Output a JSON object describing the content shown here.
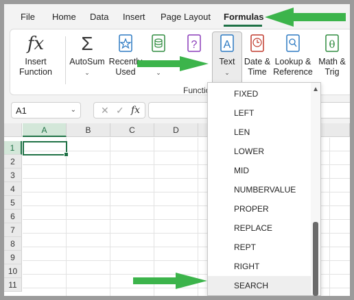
{
  "menu": {
    "tabs": [
      {
        "label": "File"
      },
      {
        "label": "Home"
      },
      {
        "label": "Data"
      },
      {
        "label": "Insert"
      },
      {
        "label": "Page Layout"
      },
      {
        "label": "Formulas"
      }
    ],
    "active": "Formulas"
  },
  "ribbon": {
    "insert_function": {
      "line1": "Insert",
      "line2": "Function"
    },
    "autosum": {
      "label": "AutoSum"
    },
    "recently_used": {
      "line1": "Recently",
      "line2": "Used"
    },
    "text": {
      "label": "Text"
    },
    "date_time": {
      "line1": "Date &",
      "line2": "Time"
    },
    "lookup": {
      "line1": "Lookup &",
      "line2": "Reference"
    },
    "math": {
      "line1": "Math &",
      "line2": "Trig"
    },
    "group_label": "Function"
  },
  "formula_bar": {
    "name_box": "A1",
    "fx": "fx"
  },
  "grid": {
    "columns": [
      "A",
      "B",
      "C",
      "D"
    ],
    "rows": [
      "1",
      "2",
      "3",
      "4",
      "5",
      "6",
      "7",
      "8",
      "9",
      "10",
      "11"
    ]
  },
  "dropdown": {
    "items": [
      "FIXED",
      "LEFT",
      "LEN",
      "LOWER",
      "MID",
      "NUMBERVALUE",
      "PROPER",
      "REPLACE",
      "REPT",
      "RIGHT",
      "SEARCH"
    ],
    "highlighted": "SEARCH"
  },
  "colors": {
    "accent": "#1e7145",
    "arrow": "#3cb44b"
  }
}
